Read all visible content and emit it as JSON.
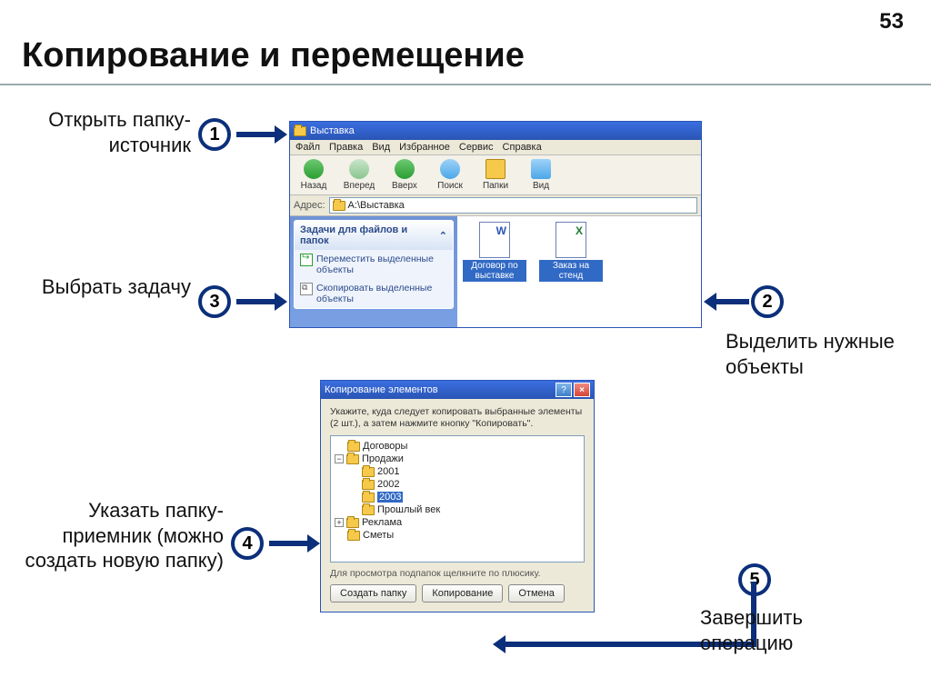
{
  "page_number": "53",
  "title": "Копирование и перемещение",
  "steps": {
    "s1": {
      "num": "1",
      "label": "Открыть папку-источник"
    },
    "s2": {
      "num": "2",
      "label": "Выделить нужные объекты"
    },
    "s3": {
      "num": "3",
      "label": "Выбрать задачу"
    },
    "s4": {
      "num": "4",
      "label": "Указать папку-приемник (можно создать новую папку)"
    },
    "s5": {
      "num": "5",
      "label": "Завершить операцию"
    }
  },
  "explorer": {
    "title": "Выставка",
    "menu": {
      "file": "Файл",
      "edit": "Правка",
      "view": "Вид",
      "fav": "Избранное",
      "tools": "Сервис",
      "help": "Справка"
    },
    "toolbar": {
      "back": "Назад",
      "fwd": "Вперед",
      "up": "Вверх",
      "search": "Поиск",
      "folders": "Папки",
      "views": "Вид"
    },
    "address_label": "Адрес:",
    "address_value": "A:\\Выставка",
    "taskpane": {
      "header": "Задачи для файлов и папок",
      "move": "Переместить выделенные объекты",
      "copy": "Скопировать выделенные объекты"
    },
    "files": {
      "f1": "Договор по выставке",
      "f2": "Заказ на стенд"
    }
  },
  "dialog": {
    "title": "Копирование элементов",
    "text": "Укажите, куда следует копировать выбранные элементы (2 шт.), а затем нажмите кнопку \"Копировать\".",
    "tree": {
      "n1": "Договоры",
      "n2": "Продажи",
      "n2a": "2001",
      "n2b": "2002",
      "n2c": "2003",
      "n2d": "Прошлый век",
      "n3": "Реклама",
      "n4": "Сметы"
    },
    "hint": "Для просмотра подпапок щелкните по плюсику.",
    "buttons": {
      "newfolder": "Создать папку",
      "copy": "Копирование",
      "cancel": "Отмена"
    }
  }
}
